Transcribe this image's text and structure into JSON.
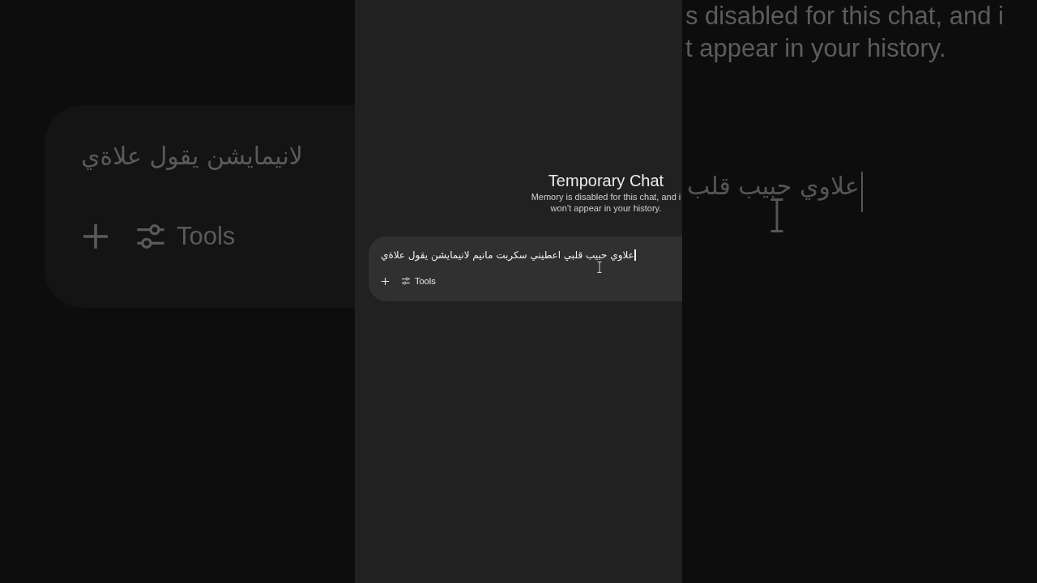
{
  "backdrop_left": {
    "input_text": "لانيمايشن يقول علاةي",
    "tools_label": "Tools"
  },
  "panel": {
    "title": "Temporary Chat",
    "subtitle_lines": [
      "Memory is disabled for this chat, and i",
      "won’t appear in your history."
    ],
    "composer": {
      "value": "علاوي حبيب قلبي اعطيني سكربت مانيم لانيمايشن يقول علاةي",
      "tools_label": "Tools"
    }
  },
  "backdrop_right": {
    "lines": [
      "s disabled for this chat, and i",
      "t appear in your history."
    ],
    "input_text": "علاوي حبيب قلب"
  }
}
